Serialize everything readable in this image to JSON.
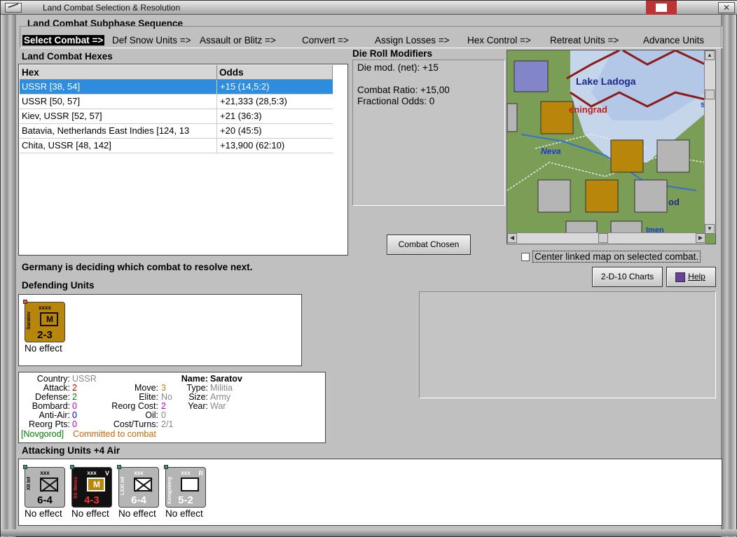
{
  "window": {
    "title": "Land Combat Selection & Resolution"
  },
  "sequence": {
    "title": "Land Combat Subphase Sequence",
    "steps": [
      "Select Combat =>",
      "Def Snow Units =>",
      "Assault or Blitz =>",
      "Convert =>",
      "Assign Losses =>",
      "Hex Control =>",
      "Retreat Units =>",
      "Advance Units"
    ]
  },
  "hexes": {
    "title": "Land Combat Hexes",
    "columns": [
      "Hex",
      "Odds"
    ],
    "rows": [
      {
        "hex": "USSR [38, 54]",
        "odds": "+15 (14,5:2)",
        "selected": true
      },
      {
        "hex": "USSR [50, 57]",
        "odds": "+21,333 (28,5:3)"
      },
      {
        "hex": "Kiev, USSR [52, 57]",
        "odds": "+21 (36:3)"
      },
      {
        "hex": "Batavia, Netherlands East Indies [124, 13",
        "odds": "+20 (45:5)"
      },
      {
        "hex": "Chita, USSR [48, 142]",
        "odds": "+13,900 (62:10)"
      }
    ]
  },
  "drm": {
    "title": "Die Roll Modifiers",
    "lines": [
      "Die mod. (net): +15",
      "",
      "Combat Ratio: +15,00",
      "Fractional Odds: 0"
    ]
  },
  "buttons": {
    "combat_chosen": "Combat Chosen",
    "charts": "2-D-10 Charts",
    "help": "Help"
  },
  "map": {
    "labels": {
      "lake": "Lake Ladoga",
      "city": "eningrad",
      "river": "Neva",
      "region1": "od",
      "region2": "Imen",
      "region3": "s"
    }
  },
  "center_linked": {
    "label": "Center linked map on selected combat.",
    "checked": false
  },
  "status": "Germany is deciding which combat to resolve next.",
  "defending": {
    "title": "Defending Units",
    "units": [
      {
        "name": "Saratov",
        "size": "xxxx",
        "strength": "2-3",
        "effect": "No effect",
        "color": "#b8860b"
      }
    ]
  },
  "info": {
    "country_label": "Country:",
    "country": "USSR",
    "attack_label": "Attack:",
    "attack": "2",
    "defense_label": "Defense:",
    "defense": "2",
    "bombard_label": "Bombard:",
    "bombard": "0",
    "antiair_label": "Anti-Air:",
    "antiair": "0",
    "reorg_label": "Reorg Pts:",
    "reorg": "0",
    "move_label": "Move:",
    "move": "3",
    "elite_label": "Elite:",
    "elite": "No",
    "reorgcost_label": "Reorg Cost:",
    "reorgcost": "2",
    "oil_label": "Oil:",
    "oil": "0",
    "costturns_label": "Cost/Turns:",
    "costturns": "2/1",
    "name_label": "Name:",
    "name": "Saratov",
    "type_label": "Type:",
    "type": "Militia",
    "size_label": "Size:",
    "size": "Army",
    "year_label": "Year:",
    "year": "War",
    "location": "[Novgorod]",
    "committed": "Committed to combat"
  },
  "attacking": {
    "title": "Attacking Units +4 Air",
    "units": [
      {
        "name": "XII Inf",
        "size": "xxx",
        "strength": "6-4",
        "effect": "No effect",
        "color": "#b5b5b5",
        "badge": ""
      },
      {
        "name": "SS Weiss",
        "size": "xxx",
        "strength": "4-3",
        "effect": "No effect",
        "color": "#111111",
        "badge": "V"
      },
      {
        "name": "LXXI Inf",
        "size": "xxx",
        "strength": "6-4",
        "effect": "No effect",
        "color": "#b5b5b5",
        "badge": ""
      },
      {
        "name": "Konigsberg",
        "size": "xxx",
        "strength": "5-2",
        "effect": "No effect",
        "color": "#b5b5b5",
        "badge": "R"
      }
    ]
  },
  "colors": {
    "selection": "#2e8ddf",
    "attack": "#d40000",
    "defense": "#008000",
    "bombard": "#c000c0",
    "antiair": "#0000c0",
    "move": "#b8860b",
    "committed": "#cc6600",
    "location": "#008000"
  }
}
